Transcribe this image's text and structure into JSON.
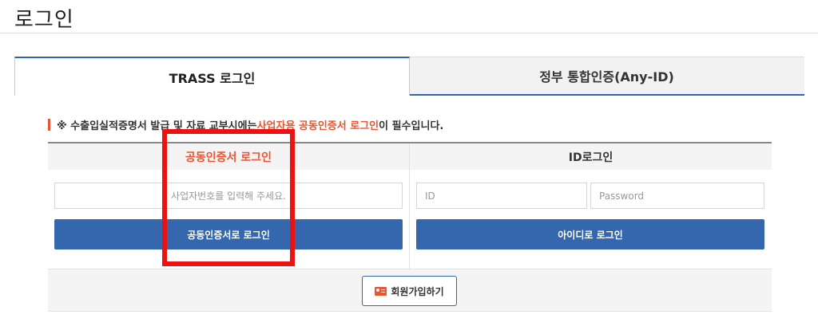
{
  "page": {
    "title": "로그인"
  },
  "tabs": [
    {
      "label": "TRASS 로그인",
      "active": true
    },
    {
      "label": "정부 통합인증(Any-ID)",
      "active": false
    }
  ],
  "notice": {
    "prefix": "※ 수출입실적증명서 발급 및 자료 교부시에는 ",
    "highlight": "사업자용 공동인증서 로그인",
    "suffix": "이 필수입니다."
  },
  "cert_login": {
    "heading": "공동인증서 로그인",
    "biz_placeholder": "사업자번호를 입력해 주세요.",
    "button_label": "공동인증서로 로그인"
  },
  "id_login": {
    "heading": "ID로그인",
    "id_placeholder": "ID",
    "password_placeholder": "Password",
    "button_label": "아이디로 로그인"
  },
  "join": {
    "label": "회원가입하기",
    "icon": "id-card-icon"
  },
  "colors": {
    "accent": "#e8552f",
    "primary": "#3467ab",
    "annotation": "#ee1111"
  }
}
